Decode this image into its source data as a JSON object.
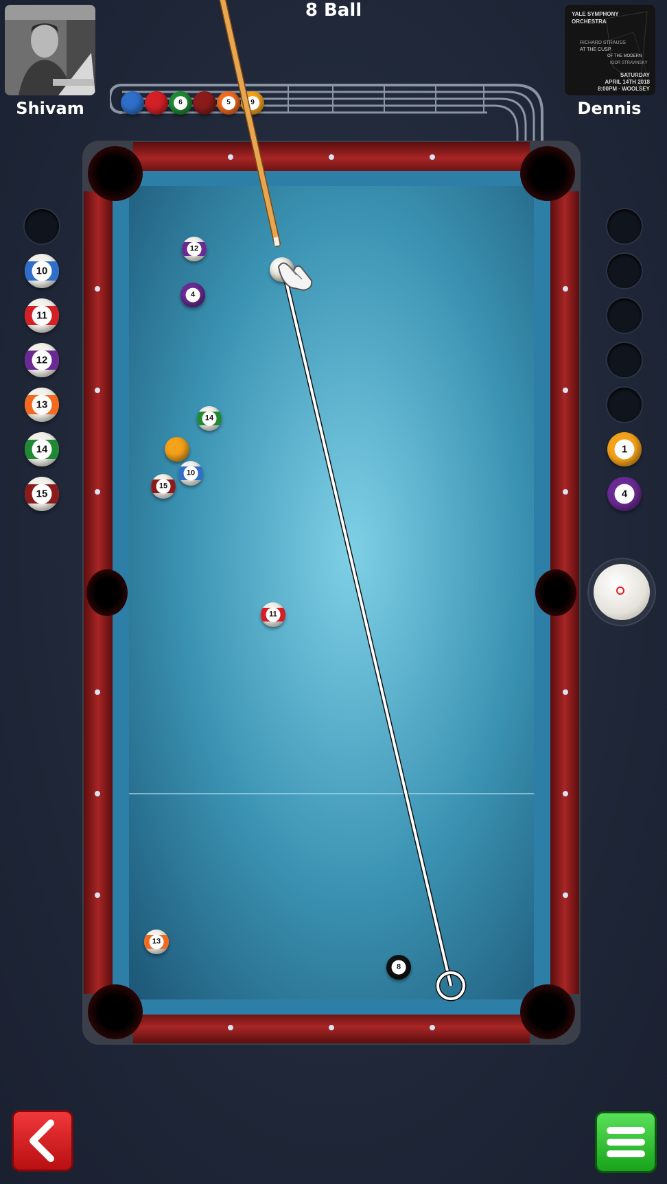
{
  "game": {
    "title": "8 Ball"
  },
  "players": {
    "left": {
      "name": "Shivam"
    },
    "right": {
      "name": "Dennis",
      "poster": {
        "line1": "YALE SYMPHONY",
        "line2": "ORCHESTRA",
        "line3": "RICHARD STRAUSS",
        "line4": "AT THE CUSP",
        "line5": "OF THE MODERN",
        "line6": "IGOR STRAVINSKY",
        "line7": "SATURDAY",
        "line8": "APRIL 14TH 2018",
        "line9": "8:00PM · WOOLSEY"
      }
    }
  },
  "colors": {
    "felt": "#3b93b3",
    "cushion": "#2e7fa8",
    "rail": "#8b1a1a",
    "accent_green": "#2bbf2e",
    "accent_red": "#d61e22"
  },
  "left_player_balls": [
    {
      "number": "",
      "empty": true
    },
    {
      "number": "10",
      "color": "#2f6fc9",
      "stripe": true
    },
    {
      "number": "11",
      "color": "#d32027",
      "stripe": true
    },
    {
      "number": "12",
      "color": "#6a2a93",
      "stripe": true
    },
    {
      "number": "13",
      "color": "#f26a1f",
      "stripe": true
    },
    {
      "number": "14",
      "color": "#1f8a33",
      "stripe": true
    },
    {
      "number": "15",
      "color": "#8b1b1b",
      "stripe": true
    }
  ],
  "right_player_balls": [
    {
      "number": "",
      "empty": true
    },
    {
      "number": "",
      "empty": true
    },
    {
      "number": "",
      "empty": true
    },
    {
      "number": "",
      "empty": true
    },
    {
      "number": "",
      "empty": true
    },
    {
      "number": "1",
      "color": "#f4a21a",
      "stripe": false
    },
    {
      "number": "4",
      "color": "#6a2a93",
      "stripe": false
    }
  ],
  "potted_rail_balls": [
    {
      "number": "",
      "color": "#2f6fc9"
    },
    {
      "number": "",
      "color": "#d32027"
    },
    {
      "number": "6",
      "color": "#1f8a33"
    },
    {
      "number": "",
      "color": "#8b1b1b"
    },
    {
      "number": "5",
      "color": "#f26a1f"
    },
    {
      "number": "9",
      "color": "#f4a21a"
    }
  ],
  "table_balls": [
    {
      "number": "12",
      "color": "#6a2a93",
      "stripe": true
    },
    {
      "number": "4",
      "color": "#6a2a93",
      "stripe": false
    },
    {
      "number": "14",
      "color": "#1f8a33",
      "stripe": true
    },
    {
      "number": "",
      "color": "#f4a21a",
      "stripe": false
    },
    {
      "number": "10",
      "color": "#2f6fc9",
      "stripe": true
    },
    {
      "number": "15",
      "color": "#8b1b1b",
      "stripe": true
    },
    {
      "number": "11",
      "color": "#d32027",
      "stripe": true
    },
    {
      "number": "13",
      "color": "#f26a1f",
      "stripe": true
    },
    {
      "number": "8",
      "color": "#111111",
      "stripe": false
    }
  ],
  "controls": {
    "back_icon": "chevron-left-icon",
    "menu_icon": "hamburger-menu-icon",
    "spin_icon": "cue-ball-spin-icon"
  }
}
